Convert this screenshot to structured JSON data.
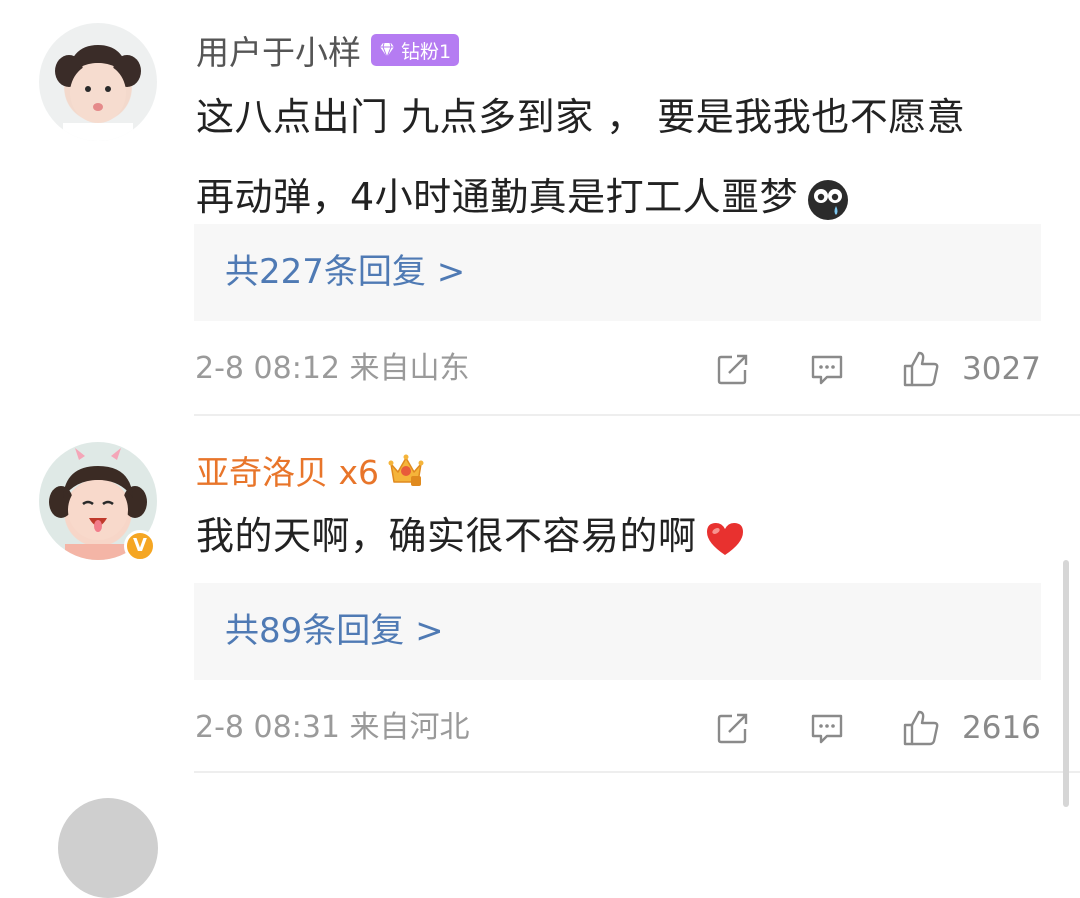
{
  "comments": [
    {
      "username": "用户于小样",
      "badge_label": "钻粉1",
      "text_line1": "这八点出门 九点多到家 ， 要是我我也不愿意",
      "text_line2": "再动弹，4小时通勤真是打工人噩梦",
      "replies_label": "共227条回复 >",
      "time_location": "2-8 08:12 来自山东",
      "like_count": "3027",
      "colors": {
        "username": "#555555",
        "badge_bg": "#b57cf2"
      }
    },
    {
      "username": "亚奇洛贝 x6",
      "text": "我的天啊，确实很不容易的啊",
      "verified_badge": "V",
      "replies_label": "共89条回复 >",
      "time_location": "2-8 08:31 来自河北",
      "like_count": "2616",
      "colors": {
        "username": "#e8752a",
        "verified": "#f5a623"
      }
    }
  ],
  "icons": [
    "diamond-icon",
    "crown-icon",
    "crying-face-emoji",
    "red-heart-emoji",
    "share-icon",
    "comment-icon",
    "like-icon"
  ],
  "colors": {
    "reply_link": "#4f7ab4",
    "reply_bg": "#f7f7f7",
    "meta_text": "#9a9a9a"
  }
}
